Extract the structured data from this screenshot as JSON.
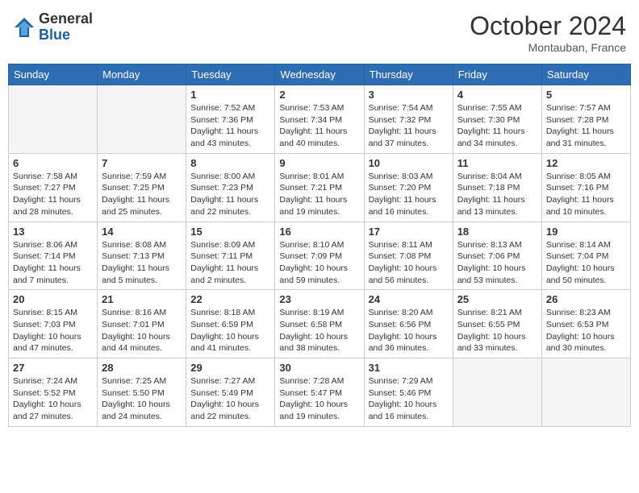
{
  "header": {
    "logo_general": "General",
    "logo_blue": "Blue",
    "month": "October 2024",
    "location": "Montauban, France"
  },
  "days_of_week": [
    "Sunday",
    "Monday",
    "Tuesday",
    "Wednesday",
    "Thursday",
    "Friday",
    "Saturday"
  ],
  "weeks": [
    [
      {
        "day": "",
        "info": ""
      },
      {
        "day": "",
        "info": ""
      },
      {
        "day": "1",
        "info": "Sunrise: 7:52 AM\nSunset: 7:36 PM\nDaylight: 11 hours and 43 minutes."
      },
      {
        "day": "2",
        "info": "Sunrise: 7:53 AM\nSunset: 7:34 PM\nDaylight: 11 hours and 40 minutes."
      },
      {
        "day": "3",
        "info": "Sunrise: 7:54 AM\nSunset: 7:32 PM\nDaylight: 11 hours and 37 minutes."
      },
      {
        "day": "4",
        "info": "Sunrise: 7:55 AM\nSunset: 7:30 PM\nDaylight: 11 hours and 34 minutes."
      },
      {
        "day": "5",
        "info": "Sunrise: 7:57 AM\nSunset: 7:28 PM\nDaylight: 11 hours and 31 minutes."
      }
    ],
    [
      {
        "day": "6",
        "info": "Sunrise: 7:58 AM\nSunset: 7:27 PM\nDaylight: 11 hours and 28 minutes."
      },
      {
        "day": "7",
        "info": "Sunrise: 7:59 AM\nSunset: 7:25 PM\nDaylight: 11 hours and 25 minutes."
      },
      {
        "day": "8",
        "info": "Sunrise: 8:00 AM\nSunset: 7:23 PM\nDaylight: 11 hours and 22 minutes."
      },
      {
        "day": "9",
        "info": "Sunrise: 8:01 AM\nSunset: 7:21 PM\nDaylight: 11 hours and 19 minutes."
      },
      {
        "day": "10",
        "info": "Sunrise: 8:03 AM\nSunset: 7:20 PM\nDaylight: 11 hours and 16 minutes."
      },
      {
        "day": "11",
        "info": "Sunrise: 8:04 AM\nSunset: 7:18 PM\nDaylight: 11 hours and 13 minutes."
      },
      {
        "day": "12",
        "info": "Sunrise: 8:05 AM\nSunset: 7:16 PM\nDaylight: 11 hours and 10 minutes."
      }
    ],
    [
      {
        "day": "13",
        "info": "Sunrise: 8:06 AM\nSunset: 7:14 PM\nDaylight: 11 hours and 7 minutes."
      },
      {
        "day": "14",
        "info": "Sunrise: 8:08 AM\nSunset: 7:13 PM\nDaylight: 11 hours and 5 minutes."
      },
      {
        "day": "15",
        "info": "Sunrise: 8:09 AM\nSunset: 7:11 PM\nDaylight: 11 hours and 2 minutes."
      },
      {
        "day": "16",
        "info": "Sunrise: 8:10 AM\nSunset: 7:09 PM\nDaylight: 10 hours and 59 minutes."
      },
      {
        "day": "17",
        "info": "Sunrise: 8:11 AM\nSunset: 7:08 PM\nDaylight: 10 hours and 56 minutes."
      },
      {
        "day": "18",
        "info": "Sunrise: 8:13 AM\nSunset: 7:06 PM\nDaylight: 10 hours and 53 minutes."
      },
      {
        "day": "19",
        "info": "Sunrise: 8:14 AM\nSunset: 7:04 PM\nDaylight: 10 hours and 50 minutes."
      }
    ],
    [
      {
        "day": "20",
        "info": "Sunrise: 8:15 AM\nSunset: 7:03 PM\nDaylight: 10 hours and 47 minutes."
      },
      {
        "day": "21",
        "info": "Sunrise: 8:16 AM\nSunset: 7:01 PM\nDaylight: 10 hours and 44 minutes."
      },
      {
        "day": "22",
        "info": "Sunrise: 8:18 AM\nSunset: 6:59 PM\nDaylight: 10 hours and 41 minutes."
      },
      {
        "day": "23",
        "info": "Sunrise: 8:19 AM\nSunset: 6:58 PM\nDaylight: 10 hours and 38 minutes."
      },
      {
        "day": "24",
        "info": "Sunrise: 8:20 AM\nSunset: 6:56 PM\nDaylight: 10 hours and 36 minutes."
      },
      {
        "day": "25",
        "info": "Sunrise: 8:21 AM\nSunset: 6:55 PM\nDaylight: 10 hours and 33 minutes."
      },
      {
        "day": "26",
        "info": "Sunrise: 8:23 AM\nSunset: 6:53 PM\nDaylight: 10 hours and 30 minutes."
      }
    ],
    [
      {
        "day": "27",
        "info": "Sunrise: 7:24 AM\nSunset: 5:52 PM\nDaylight: 10 hours and 27 minutes."
      },
      {
        "day": "28",
        "info": "Sunrise: 7:25 AM\nSunset: 5:50 PM\nDaylight: 10 hours and 24 minutes."
      },
      {
        "day": "29",
        "info": "Sunrise: 7:27 AM\nSunset: 5:49 PM\nDaylight: 10 hours and 22 minutes."
      },
      {
        "day": "30",
        "info": "Sunrise: 7:28 AM\nSunset: 5:47 PM\nDaylight: 10 hours and 19 minutes."
      },
      {
        "day": "31",
        "info": "Sunrise: 7:29 AM\nSunset: 5:46 PM\nDaylight: 10 hours and 16 minutes."
      },
      {
        "day": "",
        "info": ""
      },
      {
        "day": "",
        "info": ""
      }
    ]
  ]
}
